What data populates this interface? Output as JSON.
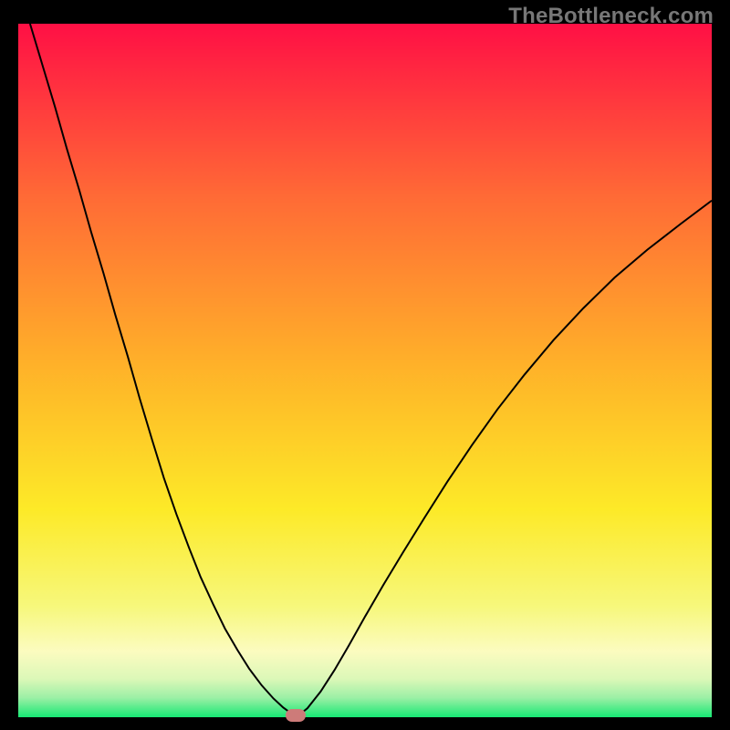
{
  "watermark": {
    "text": "TheBottleneck.com"
  },
  "chart_data": {
    "type": "line",
    "title": "",
    "xlabel": "",
    "ylabel": "",
    "xlim": [
      0,
      1
    ],
    "ylim": [
      0,
      1
    ],
    "background": {
      "kind": "vertical-gradient",
      "stops": [
        {
          "offset": 0.0,
          "color": "#ff1045"
        },
        {
          "offset": 0.25,
          "color": "#ff6b36"
        },
        {
          "offset": 0.5,
          "color": "#ffb429"
        },
        {
          "offset": 0.7,
          "color": "#fdea28"
        },
        {
          "offset": 0.84,
          "color": "#f7f87c"
        },
        {
          "offset": 0.905,
          "color": "#fcfcc0"
        },
        {
          "offset": 0.945,
          "color": "#dcf8b8"
        },
        {
          "offset": 0.972,
          "color": "#9cf0a6"
        },
        {
          "offset": 1.0,
          "color": "#17e874"
        }
      ]
    },
    "series": [
      {
        "name": "bottleneck-curve",
        "color": "#000000",
        "stroke_width": 2,
        "x": [
          0.017,
          0.035,
          0.053,
          0.07,
          0.088,
          0.105,
          0.123,
          0.14,
          0.158,
          0.175,
          0.193,
          0.21,
          0.228,
          0.246,
          0.263,
          0.281,
          0.298,
          0.316,
          0.333,
          0.351,
          0.368,
          0.382,
          0.393,
          0.4,
          0.406,
          0.417,
          0.436,
          0.456,
          0.477,
          0.5,
          0.526,
          0.555,
          0.586,
          0.619,
          0.654,
          0.691,
          0.73,
          0.772,
          0.815,
          0.86,
          0.907,
          0.956,
          1.0
        ],
        "y": [
          1.0,
          0.94,
          0.88,
          0.82,
          0.76,
          0.7,
          0.64,
          0.58,
          0.52,
          0.46,
          0.4,
          0.345,
          0.293,
          0.245,
          0.202,
          0.163,
          0.128,
          0.097,
          0.07,
          0.046,
          0.027,
          0.014,
          0.006,
          0.002,
          0.004,
          0.013,
          0.037,
          0.068,
          0.104,
          0.145,
          0.19,
          0.238,
          0.288,
          0.34,
          0.392,
          0.444,
          0.494,
          0.544,
          0.59,
          0.634,
          0.674,
          0.712,
          0.745
        ]
      }
    ],
    "marker": {
      "x": 0.4,
      "y": 0.003,
      "color": "#cd7b79",
      "shape": "pill"
    }
  }
}
